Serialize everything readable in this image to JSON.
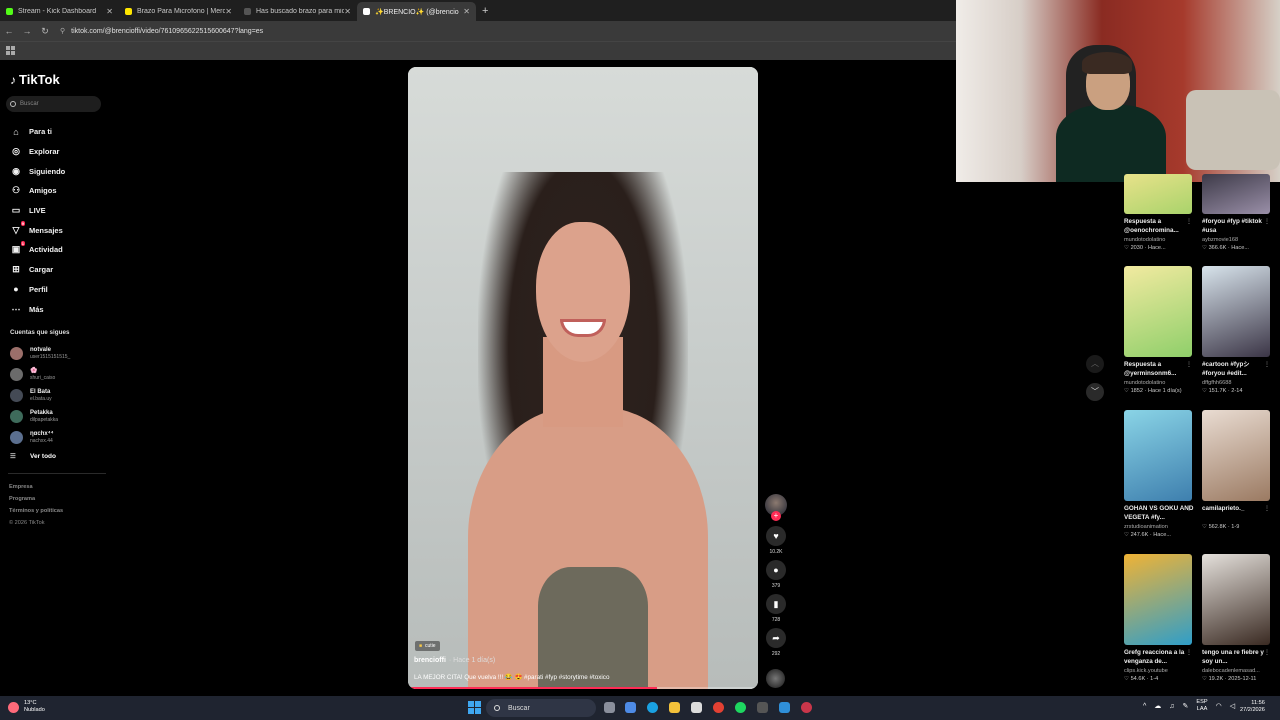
{
  "browser": {
    "tabs": [
      {
        "label": "Stream - Kick Dashboard",
        "color": "#53fc18",
        "active": false
      },
      {
        "label": "Brazo Para Microfono | Mercad",
        "color": "#ffe600",
        "active": false
      },
      {
        "label": "Has buscado brazo para microf",
        "color": "#555555",
        "active": false
      },
      {
        "label": "✨BRENCIO✨ (@brencio",
        "color": "#ffffff",
        "active": true
      }
    ],
    "new_tab": "+",
    "url": "tiktok.com/@brencioffi/video/7610965622515600647?lang=es"
  },
  "sidebar": {
    "logo": "TikTok",
    "search_placeholder": "Buscar",
    "nav": [
      {
        "label": "Para ti",
        "icon": "⌂",
        "badge": ""
      },
      {
        "label": "Explorar",
        "icon": "◎",
        "badge": ""
      },
      {
        "label": "Siguiendo",
        "icon": "◉",
        "badge": ""
      },
      {
        "label": "Amigos",
        "icon": "⚇",
        "badge": ""
      },
      {
        "label": "LIVE",
        "icon": "▭",
        "badge": ""
      },
      {
        "label": "Mensajes",
        "icon": "▽",
        "badge": "9"
      },
      {
        "label": "Actividad",
        "icon": "▣",
        "badge": "1"
      },
      {
        "label": "Cargar",
        "icon": "⊞",
        "badge": ""
      },
      {
        "label": "Perfil",
        "icon": "●",
        "badge": ""
      },
      {
        "label": "Más",
        "icon": "⋯",
        "badge": ""
      }
    ],
    "following_title": "Cuentas que sigues",
    "following": [
      {
        "name": "notvale",
        "user": "user1515151515_",
        "color": "#9b6f6a"
      },
      {
        "name": "🌸",
        "user": "shuri_caiso",
        "color": "#6b6b6b"
      },
      {
        "name": "El Bata",
        "user": "el.bata.uy",
        "color": "#444a55"
      },
      {
        "name": "Petakka",
        "user": "dilpapetakka",
        "color": "#3e6b5b"
      },
      {
        "name": "ηαchx⁴⁴",
        "user": "nachxx.44",
        "color": "#5b6f8f"
      }
    ],
    "see_all": "Ver todo",
    "footer": [
      "Empresa",
      "Programa",
      "Términos y políticas"
    ],
    "copyright": "© 2026 TikTok"
  },
  "video": {
    "tag": "cutie",
    "author": "brencioffi",
    "time": "· Hace 1 día(s)",
    "caption": "LA MEJOR CITA! Que vuelva !!! 😂 😍 #parati #fyp #storytime #toxico",
    "progress": 0.71
  },
  "actions": {
    "likes": "10.2K",
    "comments": "379",
    "saves": "728",
    "shares": "292"
  },
  "recommendations": [
    {
      "title": "Respuesta a @oenochromina...",
      "user": "mundotodolatino",
      "stats": "♡ 2030 · Hace...",
      "c1": "#e8e28a",
      "c2": "#a9d36b"
    },
    {
      "title": "#foryou #fyp #tiktok #usa",
      "user": "aybzmovie168",
      "stats": "♡ 366.6K · Hace...",
      "c1": "#3d3a48",
      "c2": "#9a8fa8"
    },
    {
      "title": "Respuesta a @yerminsonm6...",
      "user": "mundotodolatino",
      "stats": "♡ 1852 · Hace 1 día(s)",
      "c1": "#f2eaa0",
      "c2": "#8fcf6a"
    },
    {
      "title": "#cartoon #fypシ #foryou #edit...",
      "user": "dffgfhh6688",
      "stats": "♡ 151.7K · 2-14",
      "c1": "#d8e4ec",
      "c2": "#3b3546"
    },
    {
      "title": "GOHAN VS GOKU AND VEGETA #fy...",
      "user": "zrstudioanimation",
      "stats": "♡ 247.6K · Hace...",
      "c1": "#8ad4e6",
      "c2": "#3e7fae"
    },
    {
      "title": "camilaprieto._",
      "user": "",
      "stats": "♡ 562.8K · 1-9",
      "c1": "#e9dcd2",
      "c2": "#9b7a62"
    },
    {
      "title": "Grefg reacciona a la venganza de...",
      "user": "clips.kick.youtube",
      "stats": "♡ 54.6K · 1-4",
      "c1": "#f0b335",
      "c2": "#2f9ec9"
    },
    {
      "title": "tengo una re fiebre y soy un...",
      "user": "dalebocadenlemasad...",
      "stats": "♡ 19.2K · 2025-12-11",
      "c1": "#e5e1dc",
      "c2": "#3a2a22"
    }
  ],
  "taskbar": {
    "weather_temp": "13°C",
    "weather_desc": "Nublado",
    "search": "Buscar",
    "lang_top": "ESP",
    "lang_bottom": "LAA",
    "time": "11:56",
    "date": "27/2/2026"
  }
}
